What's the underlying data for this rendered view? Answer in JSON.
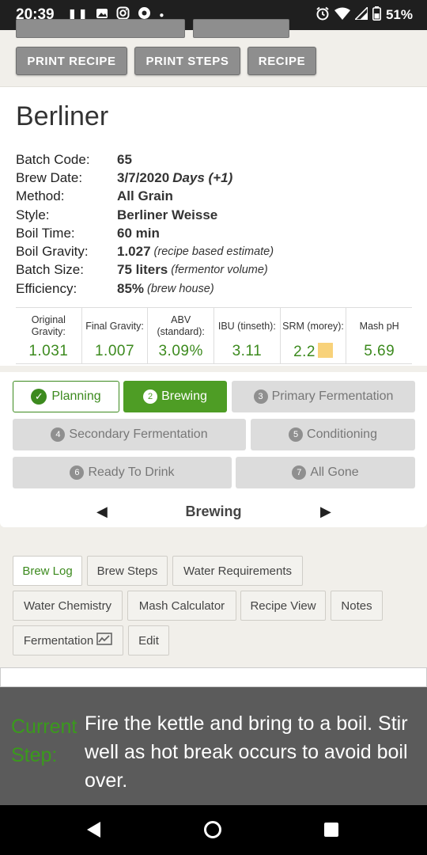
{
  "status_bar": {
    "time": "20:39",
    "battery": "51%",
    "icons": [
      "pause-icon",
      "image-icon",
      "instagram-icon",
      "app-icon",
      "dot-icon",
      "alarm-icon",
      "wifi-icon",
      "signal-icon",
      "battery-icon"
    ]
  },
  "top_buttons": {
    "print_recipe": "PRINT RECIPE",
    "print_steps": "PRINT STEPS",
    "recipe": "RECIPE"
  },
  "recipe": {
    "title": "Berliner",
    "fields": [
      {
        "label": "Batch Code:",
        "value": "65",
        "note": ""
      },
      {
        "label": "Brew Date:",
        "value": "3/7/2020",
        "note": "Days (+1)"
      },
      {
        "label": "Method:",
        "value": "All Grain",
        "note": ""
      },
      {
        "label": "Style:",
        "value": "Berliner Weisse",
        "note": ""
      },
      {
        "label": "Boil Time:",
        "value": "60 min",
        "note": ""
      },
      {
        "label": "Boil Gravity:",
        "value": "1.027",
        "note": "(recipe based estimate)"
      },
      {
        "label": "Batch Size:",
        "value": "75 liters",
        "note": "(fermentor volume)"
      },
      {
        "label": "Efficiency:",
        "value": "85%",
        "note": "(brew house)"
      }
    ],
    "stats": [
      {
        "label": "Original Gravity:",
        "value": "1.031"
      },
      {
        "label": "Final Gravity:",
        "value": "1.007"
      },
      {
        "label": "ABV (standard):",
        "value": "3.09%"
      },
      {
        "label": "IBU (tinseth):",
        "value": "3.11"
      },
      {
        "label": "SRM (morey):",
        "value": "2.2"
      },
      {
        "label": "Mash pH",
        "value": "5.69"
      }
    ],
    "srm_color": "#f8d27a"
  },
  "stages": {
    "items": [
      {
        "num": "",
        "label": "Planning",
        "state": "done"
      },
      {
        "num": "2",
        "label": "Brewing",
        "state": "active"
      },
      {
        "num": "3",
        "label": "Primary Fermentation",
        "state": "pending"
      },
      {
        "num": "4",
        "label": "Secondary Fermentation",
        "state": "pending"
      },
      {
        "num": "5",
        "label": "Conditioning",
        "state": "pending"
      },
      {
        "num": "6",
        "label": "Ready To Drink",
        "state": "pending"
      },
      {
        "num": "7",
        "label": "All Gone",
        "state": "pending"
      }
    ],
    "current": "Brewing"
  },
  "tabs": [
    {
      "label": "Brew Log",
      "active": true
    },
    {
      "label": "Brew Steps",
      "active": false
    },
    {
      "label": "Water Requirements",
      "active": false
    },
    {
      "label": "Water Chemistry",
      "active": false
    },
    {
      "label": "Mash Calculator",
      "active": false
    },
    {
      "label": "Recipe View",
      "active": false
    },
    {
      "label": "Notes",
      "active": false
    },
    {
      "label": "Fermentation",
      "active": false
    },
    {
      "label": "Edit",
      "active": false
    }
  ],
  "current_step": {
    "label_line1": "Current",
    "label_line2": "Step:",
    "text": "Fire the kettle and bring to a boil. Stir well as hot break occurs to avoid boil over."
  },
  "colors": {
    "accent_green": "#3c8a1e",
    "active_pill": "#4e9d25",
    "button_gray": "#8e8e8e"
  }
}
